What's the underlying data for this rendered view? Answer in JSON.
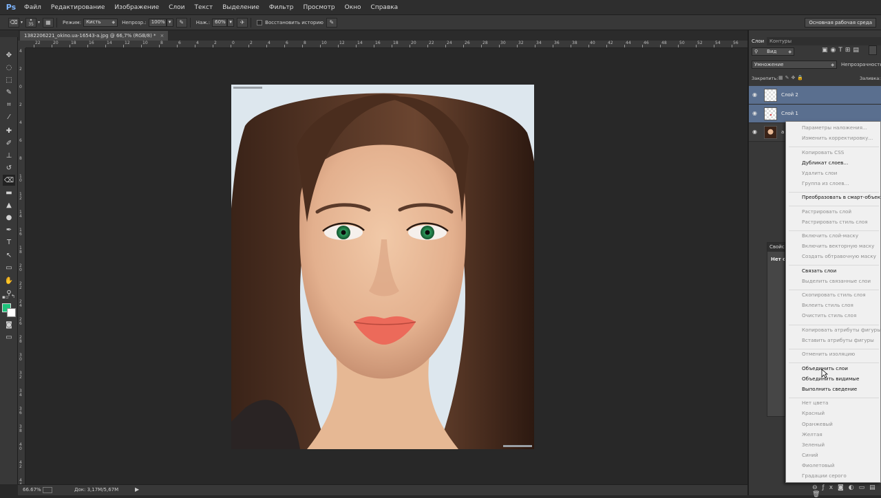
{
  "app": {
    "logo": "Ps"
  },
  "menu": [
    "Файл",
    "Редактирование",
    "Изображение",
    "Слои",
    "Текст",
    "Выделение",
    "Фильтр",
    "Просмотр",
    "Окно",
    "Справка"
  ],
  "options": {
    "brush_size": "35",
    "mode_label": "Режим:",
    "mode_value": "Кисть",
    "opacity_label": "Непрозр.:",
    "opacity_value": "100%",
    "flow_label": "Наж.:",
    "flow_value": "60%",
    "history_label": "Восстановить историю",
    "workspace": "Основная рабочая среда"
  },
  "document": {
    "tab_title": "1382206221_okino.ua-16543-a.jpg @ 66,7% (RGB/8) *",
    "close": "×"
  },
  "ruler_top": [
    "22",
    "20",
    "18",
    "16",
    "14",
    "12",
    "10",
    "8",
    "6",
    "4",
    "2",
    "0",
    "2",
    "4",
    "6",
    "8",
    "10",
    "12",
    "14",
    "16",
    "18",
    "20",
    "22",
    "24",
    "26",
    "28",
    "30",
    "32",
    "34",
    "36",
    "38",
    "40",
    "42",
    "44",
    "46",
    "48",
    "50",
    "52",
    "54",
    "56"
  ],
  "ruler_left": [
    "4",
    "2",
    "0",
    "2",
    "4",
    "6",
    "8",
    "1\n0",
    "1\n2",
    "1\n4",
    "1\n6",
    "1\n8",
    "2\n0",
    "2\n2",
    "2\n4",
    "2\n6",
    "2\n8",
    "3\n0",
    "3\n2",
    "3\n4",
    "3\n6",
    "3\n8",
    "4\n0",
    "4\n2",
    "4\n4"
  ],
  "status": {
    "zoom": "66.67%",
    "doc": "Док: 3,17M/5,67M"
  },
  "panel": {
    "tabs": [
      "Слои",
      "Контуры"
    ],
    "kind_filter": "Вид",
    "blend_mode": "Умножение",
    "opacity_label": "Непрозрачность:",
    "lock_label": "Закрепить:",
    "fill_label": "Заливка:",
    "layers": [
      {
        "name": "Слой 2",
        "selected": true
      },
      {
        "name": "Слой 1",
        "selected": true
      },
      {
        "name": "a",
        "selected": false
      }
    ],
    "side_props": "Свойст",
    "side_none": "Нет св"
  },
  "context_menu": [
    {
      "label": "Параметры наложения...",
      "enabled": false
    },
    {
      "label": "Изменить корректировку...",
      "enabled": false
    },
    {
      "sep": true
    },
    {
      "label": "Копировать CSS",
      "enabled": false
    },
    {
      "label": "Дубликат слоев...",
      "enabled": true
    },
    {
      "label": "Удалить слои",
      "enabled": false
    },
    {
      "label": "Группа из слоев...",
      "enabled": false
    },
    {
      "sep": true
    },
    {
      "label": "Преобразовать в смарт-объект",
      "enabled": true
    },
    {
      "sep": true
    },
    {
      "label": "Растрировать слой",
      "enabled": false
    },
    {
      "label": "Растрировать стиль слоя",
      "enabled": false
    },
    {
      "sep": true
    },
    {
      "label": "Включить слой-маску",
      "enabled": false
    },
    {
      "label": "Включить векторную маску",
      "enabled": false
    },
    {
      "label": "Создать обтравочную маску",
      "enabled": false
    },
    {
      "sep": true
    },
    {
      "label": "Связать слои",
      "enabled": true
    },
    {
      "label": "Выделить связанные слои",
      "enabled": false
    },
    {
      "sep": true
    },
    {
      "label": "Скопировать стиль слоя",
      "enabled": false
    },
    {
      "label": "Вклеить стиль слоя",
      "enabled": false
    },
    {
      "label": "Очистить стиль слоя",
      "enabled": false
    },
    {
      "sep": true
    },
    {
      "label": "Копировать атрибуты фигуры",
      "enabled": false
    },
    {
      "label": "Вставить атрибуты фигуры",
      "enabled": false
    },
    {
      "sep": true
    },
    {
      "label": "Отменить изоляцию",
      "enabled": false
    },
    {
      "sep": true
    },
    {
      "label": "Объединить слои",
      "enabled": true,
      "hover": true
    },
    {
      "label": "Объединить видимые",
      "enabled": true
    },
    {
      "label": "Выполнить сведение",
      "enabled": true
    },
    {
      "sep": true
    },
    {
      "label": "Нет цвета",
      "enabled": false
    },
    {
      "label": "Красный",
      "enabled": false
    },
    {
      "label": "Оранжевый",
      "enabled": false
    },
    {
      "label": "Желтая",
      "enabled": false
    },
    {
      "label": "Зеленый",
      "enabled": false
    },
    {
      "label": "Синий",
      "enabled": false
    },
    {
      "label": "Фиолетовый",
      "enabled": false
    },
    {
      "label": "Градации серого",
      "enabled": false
    }
  ],
  "colors": {
    "foreground": "#1ec17b",
    "background": "#ffffff",
    "layer_selected": "#5a6f8f"
  }
}
